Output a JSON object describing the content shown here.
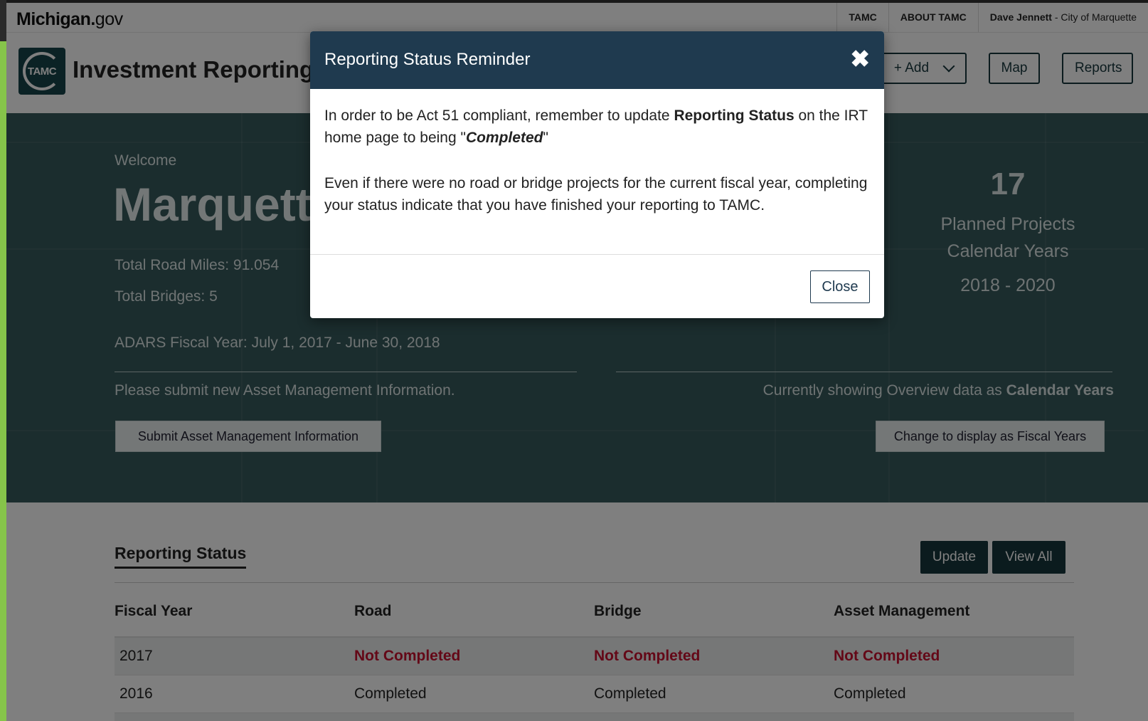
{
  "topbar": {
    "brand_bold": "Michigan.",
    "brand_light": "gov",
    "links": [
      "TAMC",
      "ABOUT TAMC"
    ],
    "user_name": "Dave Jennett",
    "user_org": " - City of Marquette"
  },
  "header": {
    "logo_text": "TAMC",
    "app_title": "Investment Reporting T",
    "add_label": "+ Add",
    "map_label": "Map",
    "reports_label": "Reports"
  },
  "hero": {
    "welcome": "Welcome",
    "city": "Marquett",
    "road_miles": "Total Road Miles: 91.054",
    "bridges": "Total Bridges: 5",
    "adars": "ADARS Fiscal Year: July 1, 2017 - June 30, 2018",
    "submit_prompt": "Please submit new Asset Management Information.",
    "submit_button": "Submit Asset Management Information",
    "showing_prefix": "Currently showing Overview data as ",
    "showing_mode": "Calendar Years",
    "change_button": "Change to display as Fiscal Years",
    "planned_count": "17",
    "planned_label1": "Planned Projects",
    "planned_label2": "Calendar Years",
    "planned_range": "2018 - 2020"
  },
  "status": {
    "title": "Reporting Status",
    "update_button": "Update",
    "view_all_button": "View All",
    "columns": [
      "Fiscal Year",
      "Road",
      "Bridge",
      "Asset Management"
    ],
    "rows": [
      {
        "year": "2017",
        "road": "Not Completed",
        "bridge": "Not Completed",
        "asset": "Not Completed"
      },
      {
        "year": "2016",
        "road": "Completed",
        "bridge": "Completed",
        "asset": "Completed"
      }
    ]
  },
  "modal": {
    "title": "Reporting Status Reminder",
    "p1_a": "In order to be Act 51 compliant, remember to update ",
    "p1_b": "Reporting Status",
    "p1_c": " on the IRT home page to being \"",
    "p1_d": "Completed",
    "p1_e": "\"",
    "p2": "Even if there were no road or bridge projects for the current fiscal year, completing your status indicate that you have finished your reporting to TAMC.",
    "close_label": "Close"
  },
  "colors": {
    "header_navy": "#1f3a4f",
    "button_teal": "#17373d",
    "hero_bg": "#375a5c",
    "alert_red": "#c8102e",
    "accent_green": "#86c44a"
  }
}
